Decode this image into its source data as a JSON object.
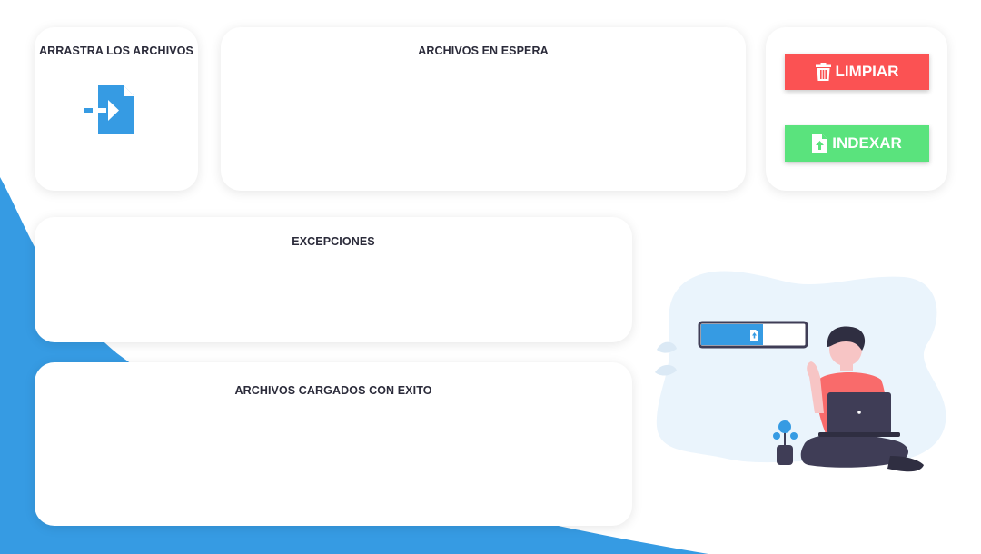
{
  "drop_panel": {
    "title": "ARRASTRA LOS ARCHIVOS",
    "icon": "file-import-icon"
  },
  "waiting_panel": {
    "title": "ARCHIVOS EN ESPERA",
    "items": []
  },
  "actions": {
    "clear_label": "LIMPIAR",
    "clear_icon": "trash-icon",
    "index_label": "INDEXAR",
    "index_icon": "file-upload-icon"
  },
  "exceptions_panel": {
    "title": "EXCEPCIONES",
    "items": []
  },
  "success_panel": {
    "title": "ARCHIVOS CARGADOS CON EXITO",
    "items": []
  },
  "illustration": {
    "upload_progress": 0.6
  },
  "colors": {
    "accent_blue": "#369be3",
    "danger_red": "#fb5253",
    "success_green": "#5ae37d",
    "text_dark": "#2b2b3a",
    "blob_light": "#eaf4fc"
  }
}
